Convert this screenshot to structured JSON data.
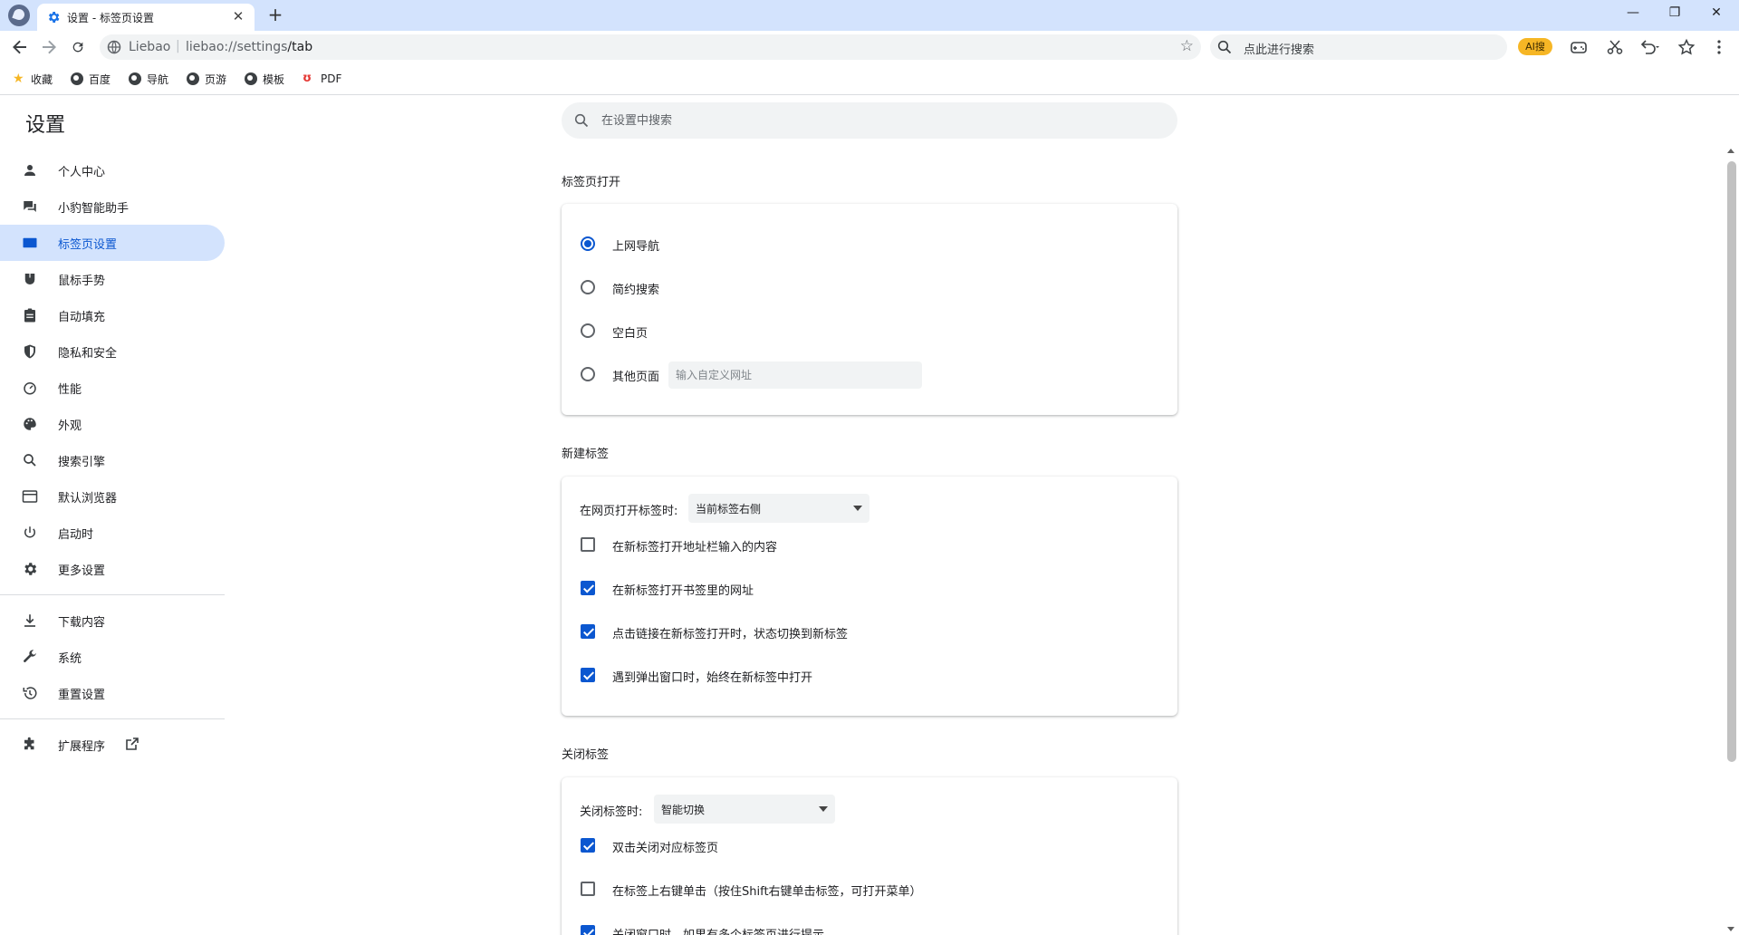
{
  "browser": {
    "tab_title": "设置 - 标签页设置",
    "new_tab_label": "+",
    "close_tab_label": "✕",
    "window_controls": {
      "minimize": "—",
      "restore": "❐",
      "close": "✕"
    }
  },
  "toolbar": {
    "url_brand": "Liebao",
    "url_separator": "|",
    "url_scheme_host": "liebao://settings",
    "url_path": "/tab",
    "search_placeholder": "点此进行搜索",
    "ai_badge": "AI搜"
  },
  "bookmarks": [
    {
      "label": "收藏",
      "icon": "star-icon"
    },
    {
      "label": "百度",
      "icon": "globe-icon"
    },
    {
      "label": "导航",
      "icon": "globe-icon"
    },
    {
      "label": "页游",
      "icon": "globe-icon"
    },
    {
      "label": "模板",
      "icon": "globe-icon"
    },
    {
      "label": "PDF",
      "icon": "pdf-icon"
    }
  ],
  "sidebar": {
    "title": "设置",
    "items": [
      {
        "label": "个人中心",
        "icon": "person-icon"
      },
      {
        "label": "小豹智能助手",
        "icon": "assistant-icon"
      },
      {
        "label": "标签页设置",
        "icon": "tab-icon",
        "active": true
      },
      {
        "label": "鼠标手势",
        "icon": "mouse-icon"
      },
      {
        "label": "自动填充",
        "icon": "clipboard-icon"
      },
      {
        "label": "隐私和安全",
        "icon": "shield-icon"
      },
      {
        "label": "性能",
        "icon": "speedometer-icon"
      },
      {
        "label": "外观",
        "icon": "palette-icon"
      },
      {
        "label": "搜索引擎",
        "icon": "search-icon"
      },
      {
        "label": "默认浏览器",
        "icon": "browser-icon"
      },
      {
        "label": "启动时",
        "icon": "power-icon"
      },
      {
        "label": "更多设置",
        "icon": "gear-icon"
      },
      {
        "label": "下载内容",
        "icon": "download-icon"
      },
      {
        "label": "系统",
        "icon": "wrench-icon"
      },
      {
        "label": "重置设置",
        "icon": "restore-icon"
      },
      {
        "label": "扩展程序",
        "icon": "puzzle-icon"
      }
    ]
  },
  "main": {
    "search_placeholder": "在设置中搜索",
    "tab_open": {
      "title": "标签页打开",
      "options": [
        {
          "label": "上网导航",
          "checked": true
        },
        {
          "label": "简约搜索",
          "checked": false
        },
        {
          "label": "空白页",
          "checked": false
        },
        {
          "label": "其他页面",
          "checked": false
        }
      ],
      "custom_url_placeholder": "输入自定义网址"
    },
    "new_tab": {
      "title": "新建标签",
      "open_position_label": "在网页打开标签时:",
      "open_position_value": "当前标签右侧",
      "options": [
        {
          "label": "在新标签打开地址栏输入的内容",
          "checked": false
        },
        {
          "label": "在新标签打开书签里的网址",
          "checked": true
        },
        {
          "label": "点击链接在新标签打开时，状态切换到新标签",
          "checked": true
        },
        {
          "label": "遇到弹出窗口时，始终在新标签中打开",
          "checked": true
        }
      ]
    },
    "close_tab": {
      "title": "关闭标签",
      "close_behavior_label": "关闭标签时:",
      "close_behavior_value": "智能切换",
      "options": [
        {
          "label": "双击关闭对应标签页",
          "checked": true
        },
        {
          "label": "在标签上右键单击（按住Shift右键单击标签，可打开菜单）",
          "checked": false
        },
        {
          "label": "关闭窗口时，如果有多个标签页进行提示",
          "checked": true
        }
      ]
    }
  },
  "colors": {
    "accent": "#0b57d0",
    "tabstrip": "#d3e3fd",
    "active_menu_bg": "#d3e3fd",
    "ai_badge": "#f6b625"
  }
}
